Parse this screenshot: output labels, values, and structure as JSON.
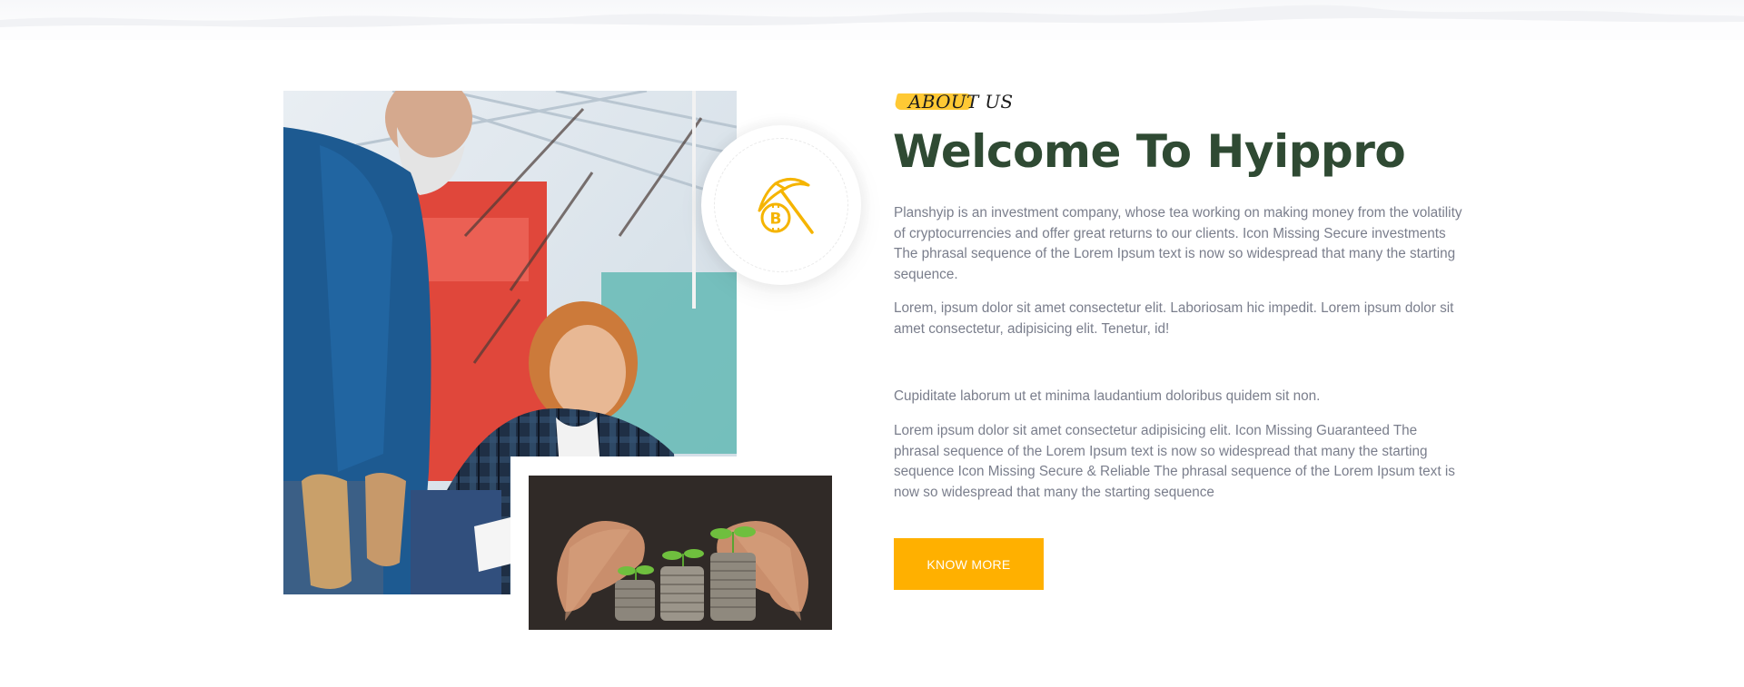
{
  "about": {
    "tag": "ABOUT US",
    "heading": "Welcome To Hyippro",
    "paragraphs": [
      "Planshyip is an investment company, whose tea working on making money from the volatility of cryptocurrencies and offer great returns to our clients. Icon Missing Secure investments The phrasal sequence of the Lorem Ipsum text is now so widespread that many the starting sequence.",
      "Lorem, ipsum dolor sit amet consectetur elit. Laboriosam hic impedit. Lorem ipsum dolor sit amet consectetur, adipisicing elit. Tenetur, id!",
      "Cupiditate laborum ut et minima laudantium doloribus quidem sit non.",
      "Lorem ipsum dolor sit amet consectetur adipisicing elit. Icon Missing Guaranteed The phrasal sequence of the Lorem Ipsum text is now so widespread that many the starting sequence Icon Missing Secure & Reliable The phrasal sequence of the Lorem Ipsum text is now so widespread that many the starting sequence"
    ],
    "cta_label": "KNOW MORE"
  },
  "images": {
    "main_photo": "photo-gardening-couple",
    "inset_photo": "photo-seedlings-on-coin-stacks",
    "badge_icon": "pickaxe-bitcoin-icon"
  },
  "colors": {
    "accent": "#ffb000",
    "heading": "#2f4a33",
    "body_text": "#7a7e8c",
    "tag_highlight": "#ffc629"
  }
}
